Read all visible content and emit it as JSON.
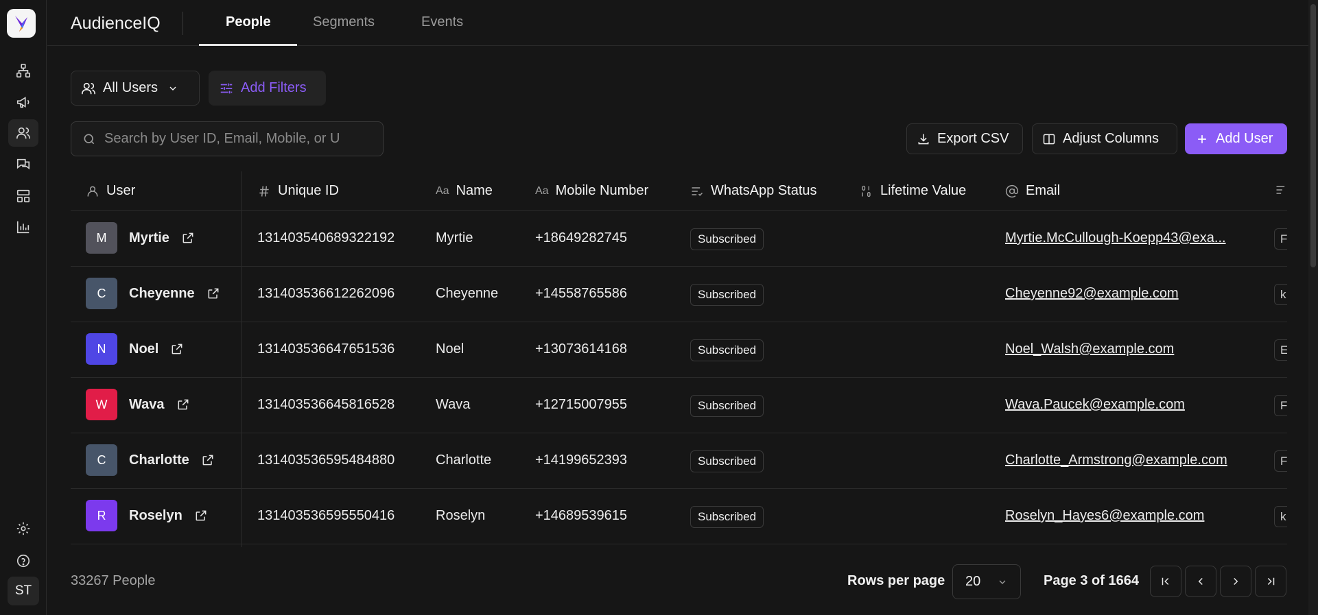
{
  "app": {
    "title": "AudienceIQ"
  },
  "tabs": [
    {
      "label": "People",
      "active": true
    },
    {
      "label": "Segments",
      "active": false
    },
    {
      "label": "Events",
      "active": false
    }
  ],
  "rail": {
    "icons": [
      "hierarchy-icon",
      "megaphone-icon",
      "users-icon",
      "chat-icon",
      "layout-icon",
      "bar-chart-icon"
    ],
    "bottom_icons": [
      "gear-icon",
      "help-icon"
    ],
    "avatar_initials": "ST"
  },
  "toolbar": {
    "user_filter_label": "All Users",
    "add_filters_label": "Add Filters",
    "search_placeholder": "Search by User ID, Email, Mobile, or U",
    "export_label": "Export CSV",
    "adjust_label": "Adjust Columns",
    "add_user_label": "Add User"
  },
  "table": {
    "columns": [
      "User",
      "Unique ID",
      "Name",
      "Mobile Number",
      "WhatsApp Status",
      "Lifetime Value",
      "Email"
    ],
    "rows": [
      {
        "initial": "M",
        "avatar_color": "#52525b",
        "user": "Myrtie",
        "unique_id": "131403540689322192",
        "name": "Myrtie",
        "mobile": "+18649282745",
        "whatsapp": "Subscribed",
        "lifetime": "",
        "email": "Myrtie.McCullough-Koepp43@exa...",
        "extra": "F"
      },
      {
        "initial": "C",
        "avatar_color": "#475569",
        "user": "Cheyenne",
        "unique_id": "131403536612262096",
        "name": "Cheyenne",
        "mobile": "+14558765586",
        "whatsapp": "Subscribed",
        "lifetime": "",
        "email": "Cheyenne92@example.com",
        "extra": "k"
      },
      {
        "initial": "N",
        "avatar_color": "#4f46e5",
        "user": "Noel",
        "unique_id": "131403536647651536",
        "name": "Noel",
        "mobile": "+13073614168",
        "whatsapp": "Subscribed",
        "lifetime": "",
        "email": "Noel_Walsh@example.com",
        "extra": "E"
      },
      {
        "initial": "W",
        "avatar_color": "#e11d48",
        "user": "Wava",
        "unique_id": "131403536645816528",
        "name": "Wava",
        "mobile": "+12715007955",
        "whatsapp": "Subscribed",
        "lifetime": "",
        "email": "Wava.Paucek@example.com",
        "extra": "F"
      },
      {
        "initial": "C",
        "avatar_color": "#475569",
        "user": "Charlotte",
        "unique_id": "131403536595484880",
        "name": "Charlotte",
        "mobile": "+14199652393",
        "whatsapp": "Subscribed",
        "lifetime": "",
        "email": "Charlotte_Armstrong@example.com",
        "extra": "F"
      },
      {
        "initial": "R",
        "avatar_color": "#7c3aed",
        "user": "Roselyn",
        "unique_id": "131403536595550416",
        "name": "Roselyn",
        "mobile": "+14689539615",
        "whatsapp": "Subscribed",
        "lifetime": "",
        "email": "Roselyn_Hayes6@example.com",
        "extra": "k"
      }
    ]
  },
  "footer": {
    "count": "33267 People",
    "rows_per_page_label": "Rows per page",
    "rows_per_page": "20",
    "page_info": "Page 3 of 1664"
  },
  "colors": {
    "accent": "#8b5cf6",
    "background": "#161616"
  }
}
